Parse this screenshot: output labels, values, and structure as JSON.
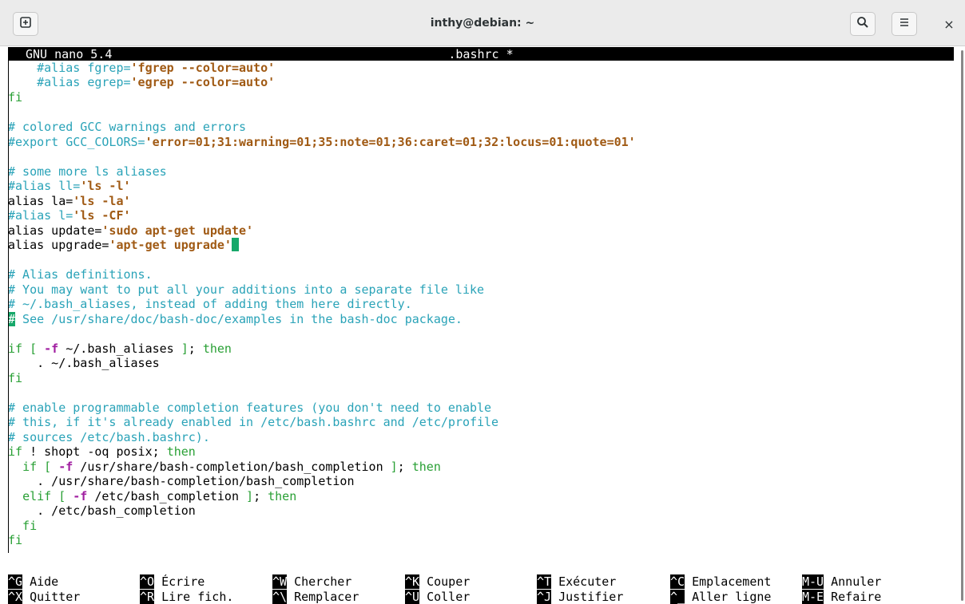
{
  "window": {
    "title": "inthy@debian: ~",
    "new_tab_icon": "new-tab-icon",
    "search_icon": "search-icon",
    "menu_icon": "hamburger-menu-icon",
    "close_glyph": "×"
  },
  "nano": {
    "version": "GNU nano 5.4",
    "filename": ".bashrc *"
  },
  "lines": [
    "    #alias fgrep='fgrep --color=auto'",
    "    #alias egrep='egrep --color=auto'",
    "fi",
    "",
    "# colored GCC warnings and errors",
    "#export GCC_COLORS='error=01;31:warning=01;35:note=01;36:caret=01;32:locus=01:quote=01'",
    "",
    "# some more ls aliases",
    "#alias ll='ls -l'",
    "alias la='ls -la'",
    "#alias l='ls -CF'",
    "alias update='sudo apt-get update'",
    "alias upgrade='apt-get upgrade'",
    "",
    "# Alias definitions.",
    "# You may want to put all your additions into a separate file like",
    "# ~/.bash_aliases, instead of adding them here directly.",
    "# See /usr/share/doc/bash-doc/examples in the bash-doc package.",
    "",
    "if [ -f ~/.bash_aliases ]; then",
    "    . ~/.bash_aliases",
    "fi",
    "",
    "# enable programmable completion features (you don't need to enable",
    "# this, if it's already enabled in /etc/bash.bashrc and /etc/profile",
    "# sources /etc/bash.bashrc).",
    "if ! shopt -oq posix; then",
    "  if [ -f /usr/share/bash-completion/bash_completion ]; then",
    "    . /usr/share/bash-completion/bash_completion",
    "  elif [ -f /etc/bash_completion ]; then",
    "    . /etc/bash_completion",
    "  fi",
    "fi"
  ],
  "shortcuts": [
    {
      "key": "^G",
      "label": "Aide"
    },
    {
      "key": "^O",
      "label": "Écrire"
    },
    {
      "key": "^W",
      "label": "Chercher"
    },
    {
      "key": "^K",
      "label": "Couper"
    },
    {
      "key": "^T",
      "label": "Exécuter"
    },
    {
      "key": "^C",
      "label": "Emplacement"
    },
    {
      "key": "M-U",
      "label": "Annuler"
    },
    {
      "key": "^X",
      "label": "Quitter"
    },
    {
      "key": "^R",
      "label": "Lire fich."
    },
    {
      "key": "^\\",
      "label": "Remplacer"
    },
    {
      "key": "^U",
      "label": "Coller"
    },
    {
      "key": "^J",
      "label": "Justifier"
    },
    {
      "key": "^_",
      "label": "Aller ligne"
    },
    {
      "key": "M-E",
      "label": "Refaire"
    }
  ],
  "colors": {
    "comment": "#2aa3b8",
    "string": "#a05a14",
    "keyword": "#29a035",
    "option": "#a01ea0",
    "cursor": "#17a86a"
  }
}
